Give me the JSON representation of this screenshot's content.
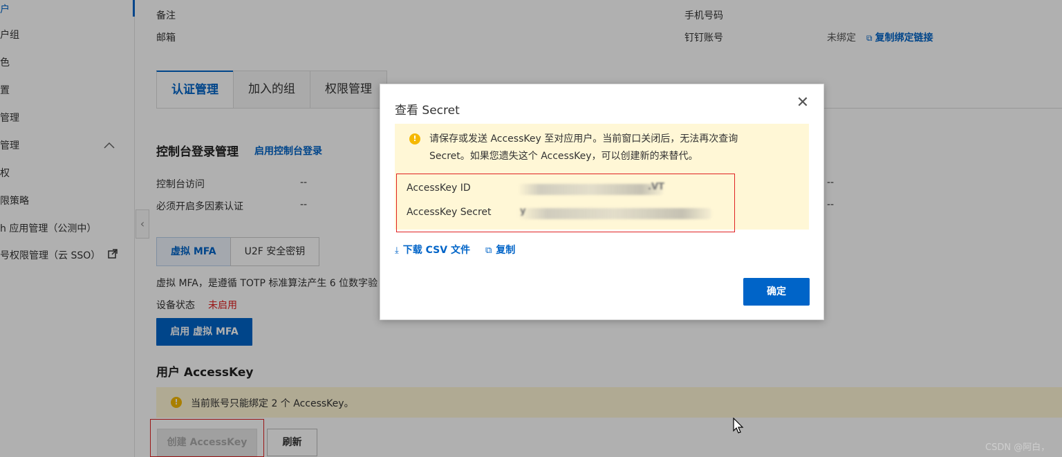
{
  "sidebar": {
    "items": [
      {
        "label": "户",
        "active": true
      },
      {
        "label": "户组"
      },
      {
        "label": "色"
      },
      {
        "label": "置"
      },
      {
        "label": "管理"
      },
      {
        "label": "管理",
        "expanded": true,
        "chevron": "chevron-up-icon"
      },
      {
        "label": "权"
      },
      {
        "label": "限策略"
      },
      {
        "label": "h 应用管理（公测中）"
      },
      {
        "label": "号权限管理（云 SSO）",
        "external": "external-link-icon"
      }
    ],
    "collapse_glyph": "‹"
  },
  "user_info": {
    "remark_label": "备注",
    "email_label": "邮箱",
    "phone_label": "手机号码",
    "dingtalk_label": "钉钉账号",
    "dingtalk_value": "未绑定",
    "copy_bind_link": "复制绑定链接"
  },
  "tabs": [
    "认证管理",
    "加入的组",
    "权限管理"
  ],
  "console_login": {
    "title": "控制台登录管理",
    "enable_link": "启用控制台登录",
    "access_label": "控制台访问",
    "access_value": "--",
    "mfa_required_label": "必须开启多因素认证",
    "mfa_required_value": "--",
    "right_value_1": "--",
    "right_value_2": "--"
  },
  "mfa": {
    "tab_virtual": "虚拟 MFA",
    "tab_u2f": "U2F 安全密钥",
    "description": "虚拟 MFA，是遵循 TOTP 标准算法产生 6 位数字验",
    "status_label": "设备状态",
    "status_value": "未启用",
    "enable_button": "启用 虚拟 MFA"
  },
  "accesskey": {
    "title": "用户 AccessKey",
    "notice": "当前账号只能绑定 2 个 AccessKey。",
    "create_button": "创建 AccessKey",
    "refresh_button": "刷新"
  },
  "modal": {
    "title": "查看 Secret",
    "close_glyph": "✕",
    "warning": "请保存或发送 AccessKey 至对应用户。当前窗口关闭后，无法再次查询 Secret。如果您遗失这个 AccessKey，可以创建新的来替代。",
    "id_label": "AccessKey ID",
    "id_value_visible": ".VT",
    "secret_label": "AccessKey Secret",
    "secret_value_visible": "y",
    "download_csv": "下载 CSV 文件",
    "copy": "复制",
    "ok_button": "确定"
  },
  "watermark": "CSDN @阿白，",
  "colors": {
    "primary": "#0064c8",
    "warning_bg": "#fff7d6",
    "warning_icon": "#f5b800",
    "danger_text": "#e02020",
    "overlay": "rgba(0,0,0,0.31)"
  }
}
